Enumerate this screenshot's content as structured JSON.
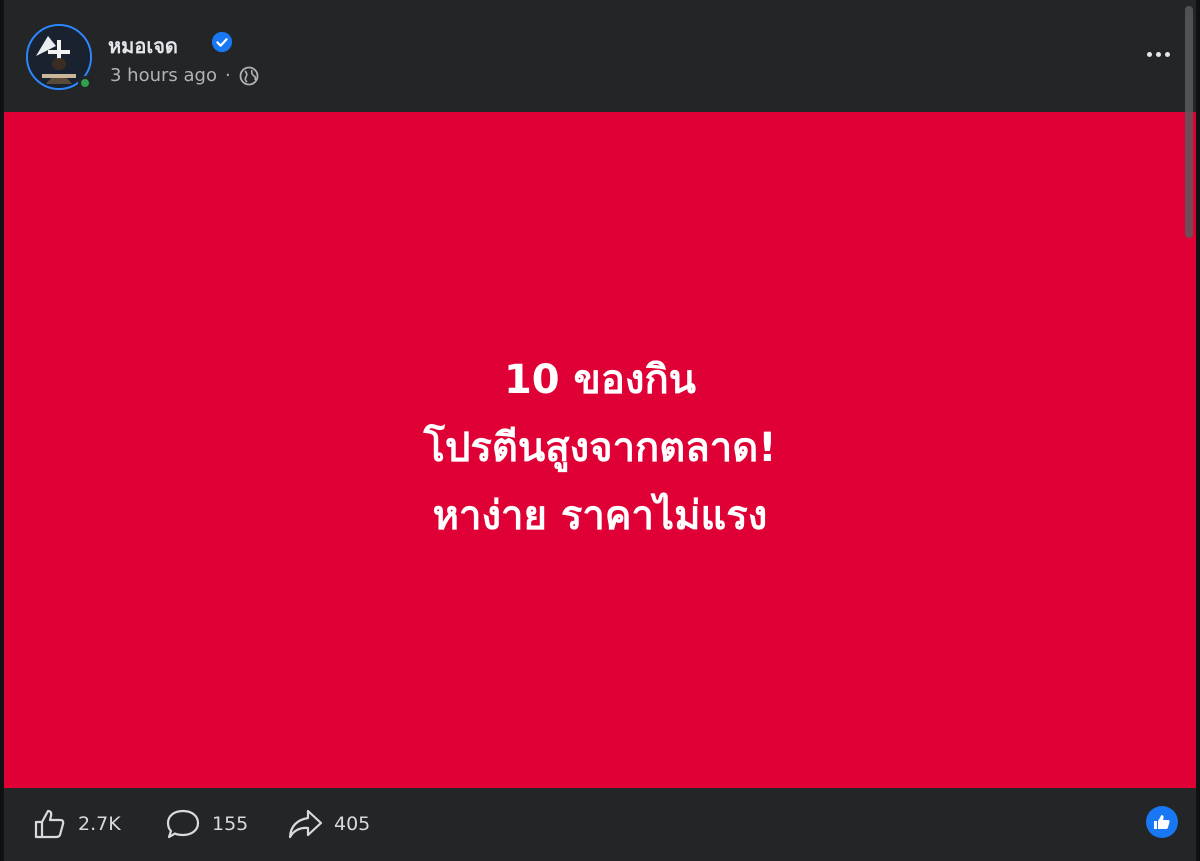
{
  "post": {
    "author": "หมอเจด",
    "timestamp": "3 hours ago",
    "separator": "·",
    "privacy_icon": "globe-icon",
    "verified_icon": "verified-badge-icon",
    "body_lines": [
      "10 ของกิน",
      "โปรตีนสูงจากตลาด!",
      "หาง่าย ราคาไม่แรง"
    ],
    "background_color": "#df0035"
  },
  "stats": {
    "likes": "2.7K",
    "comments": "155",
    "shares": "405"
  },
  "colors": {
    "accent": "#1877f2",
    "online": "#31a24c",
    "surface": "#242526"
  }
}
